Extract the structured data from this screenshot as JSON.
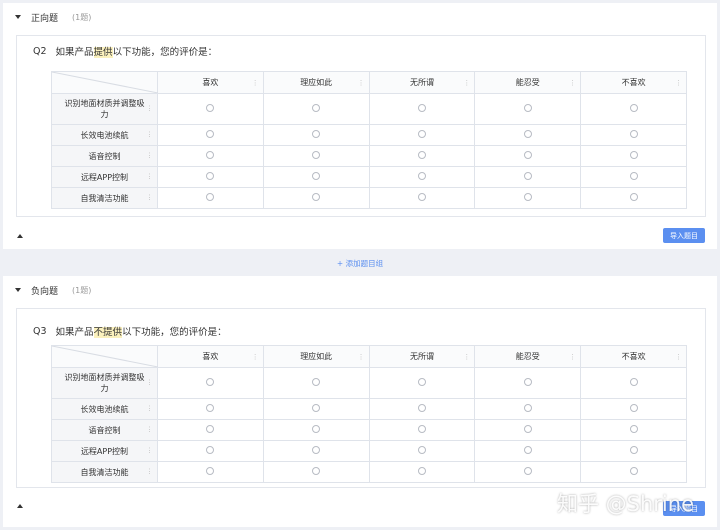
{
  "columns": [
    "喜欢",
    "理应如此",
    "无所谓",
    "能忍受",
    "不喜欢"
  ],
  "rows": [
    "识别地面材质并调整吸力",
    "长效电池续航",
    "语音控制",
    "远程APP控制",
    "自我清洁功能"
  ],
  "section1": {
    "title": "正向题",
    "count": "(1题)",
    "question_number": "Q2",
    "question_prefix": "如果产品",
    "question_highlight": "提供",
    "question_suffix": "以下功能，您的评价是：",
    "import_label": "导入题目"
  },
  "add_group_label": "+ 添加题目组",
  "section2": {
    "title": "负向题",
    "count": "(1题)",
    "question_number": "Q3",
    "question_prefix": "如果产品",
    "question_highlight": "不提供",
    "question_suffix": "以下功能，您的评价是：",
    "import_label": "导入题目"
  },
  "watermark": "知乎 @Shrine",
  "colors": {
    "accent": "#5b8ff0",
    "highlight": "#fbf1bd",
    "page_bg": "#eef0f5"
  }
}
